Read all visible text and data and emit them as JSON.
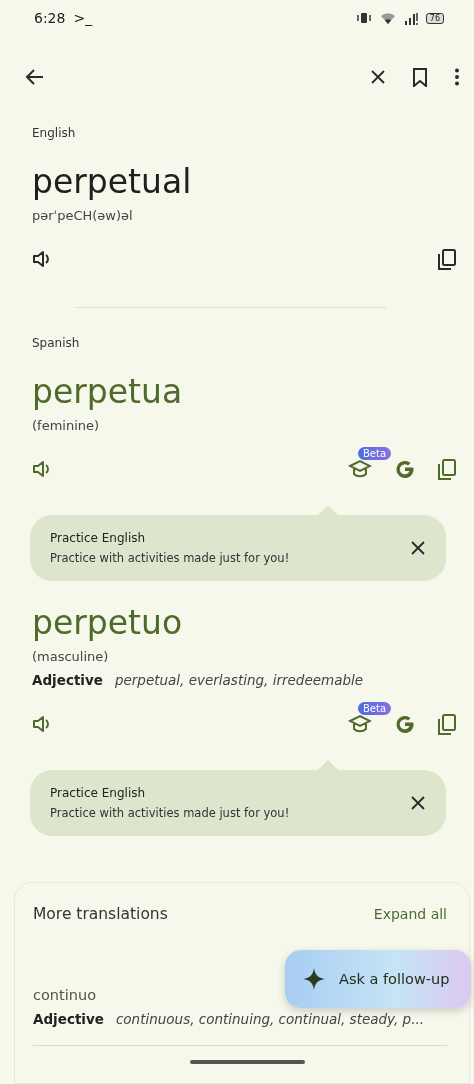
{
  "status_bar": {
    "time": "6:28",
    "prompt": ">_",
    "battery": "76"
  },
  "source": {
    "language": "English",
    "word": "perpetual",
    "phonetic": "pərˈpeCH(əw)əl"
  },
  "target": {
    "language": "Spanish",
    "entries": [
      {
        "word": "perpetua",
        "gender": "(feminine)",
        "badge": "Beta",
        "tip": {
          "title": "Practice English",
          "body": "Practice with activities made just for you!"
        }
      },
      {
        "word": "perpetuo",
        "gender": "(masculine)",
        "pos": "Adjective",
        "synonyms": "perpetual, everlasting, irredeemable",
        "badge": "Beta",
        "tip": {
          "title": "Practice English",
          "body": "Practice with activities made just for you!"
        }
      }
    ]
  },
  "more_translations": {
    "title": "More translations",
    "action": "Expand all",
    "items": [
      {
        "word": "continuo",
        "pos": "Adjective",
        "synonyms": "continuous, continuing, continual, steady, p..."
      }
    ]
  },
  "fab": {
    "label": "Ask a follow-up"
  }
}
